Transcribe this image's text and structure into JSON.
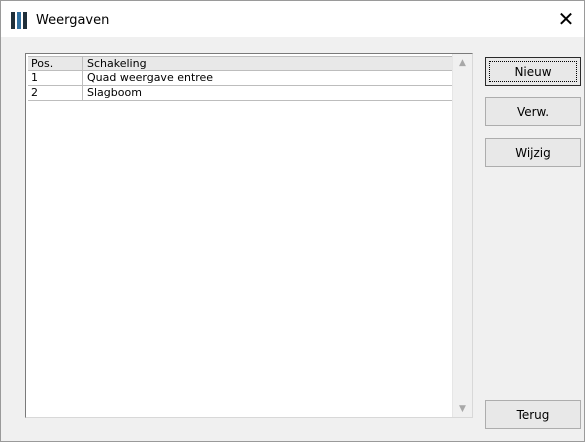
{
  "window": {
    "title": "Weergaven",
    "close_glyph": "✕",
    "icon": "app-icon"
  },
  "list": {
    "columns": [
      "Pos.",
      "Schakeling"
    ],
    "rows": [
      {
        "pos": "1",
        "name": "Quad weergave entree"
      },
      {
        "pos": "2",
        "name": "Slagboom"
      }
    ]
  },
  "buttons": {
    "new_label": "Nieuw",
    "delete_label": "Verw.",
    "edit_label": "Wijzig",
    "back_label": "Terug"
  },
  "colors": {
    "icon_dark": "#1f2f3a",
    "icon_blue": "#2f6f9f"
  }
}
